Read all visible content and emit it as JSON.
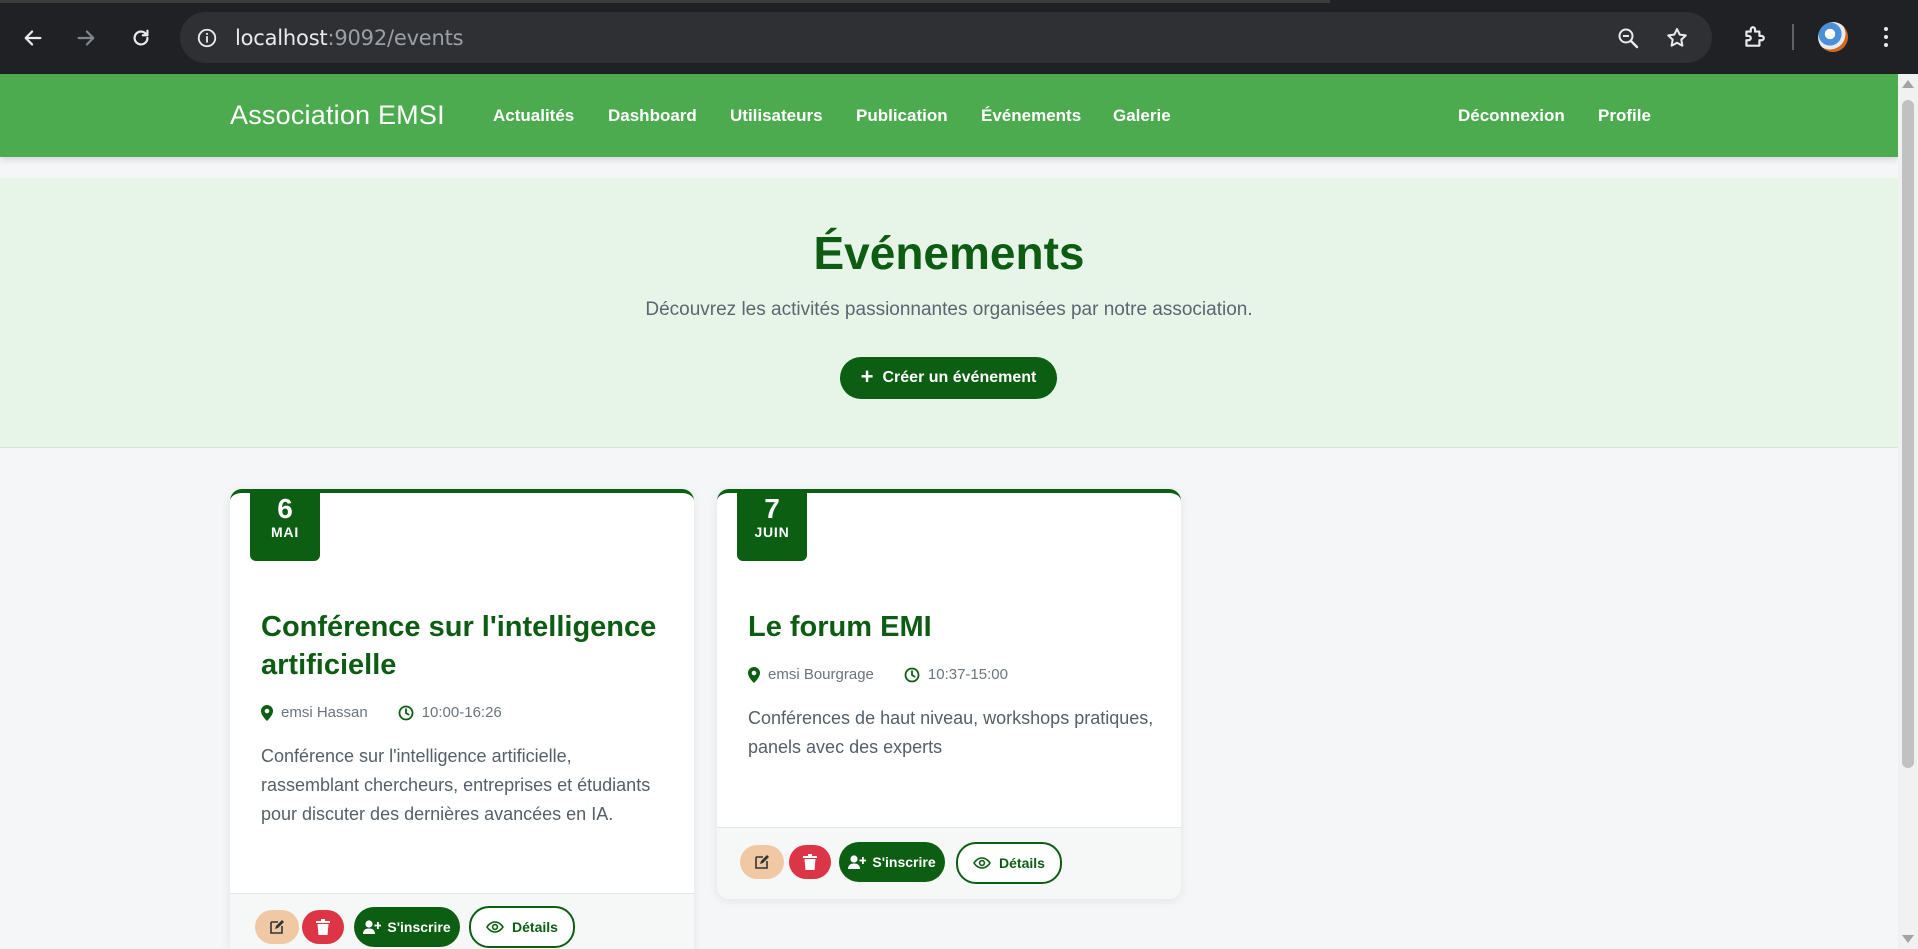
{
  "browser": {
    "url_host": "localhost",
    "url_path": ":9092/events"
  },
  "navbar": {
    "brand": "Association EMSI",
    "links": [
      "Actualités",
      "Dashboard",
      "Utilisateurs",
      "Publication",
      "Événements",
      "Galerie"
    ],
    "right_links": [
      "Déconnexion",
      "Profile"
    ]
  },
  "hero": {
    "title": "Événements",
    "subtitle": "Découvrez les activités passionnantes organisées par notre association.",
    "create_label": "Créer un événement"
  },
  "events": [
    {
      "day": "6",
      "month": "MAI",
      "title_line1": "Conférence sur l'intelligence",
      "title_line2": "artificielle",
      "location": "emsi Hassan",
      "time": "10:00-16:26",
      "desc_line1": "Conférence sur l'intelligence artificielle,",
      "desc_line2": "rassemblant chercheurs, entreprises et étudiants",
      "desc_line3": "pour discuter des dernières avancées en IA.",
      "subscribe_label": "S'inscrire",
      "details_label": "Détails"
    },
    {
      "day": "7",
      "month": "JUIN",
      "title_line1": "Le forum EMI",
      "location": "emsi Bourgrage",
      "time": "10:37-15:00",
      "desc_line1": "Conférences de haut niveau, workshops pratiques,",
      "desc_line2": "panels avec des experts",
      "subscribe_label": "S'inscrire",
      "details_label": "Détails"
    }
  ],
  "colors": {
    "navbar": "#4caa4f",
    "primary": "#0b5e12",
    "hero_bg": "#e7f5e8",
    "danger": "#dc3545",
    "edit": "#f0c9a4"
  }
}
